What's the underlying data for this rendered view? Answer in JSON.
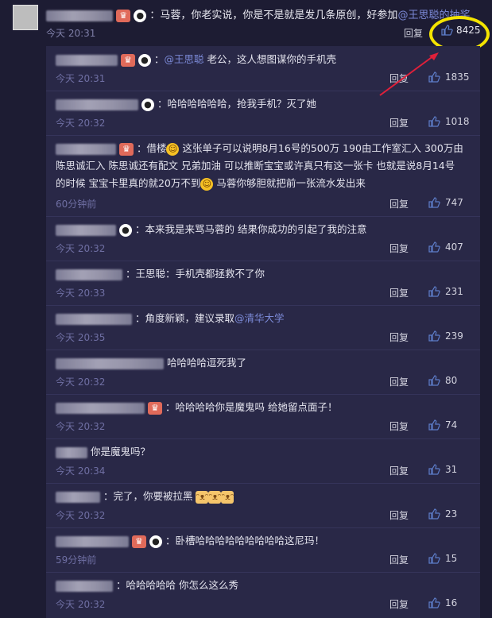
{
  "top_comment": {
    "text": "：马蓉，你老实说，你是不是就是发几条原创，好参加",
    "mention": "@王思聪的抽奖",
    "time": "今天 20:31",
    "reply_label": "回复",
    "likes": "8425"
  },
  "replies": [
    {
      "prefix": "：",
      "mention": "@王思聪",
      "text": " 老公，这人想图谋你的手机壳",
      "time": "今天 20:31",
      "reply": "回复",
      "likes": "1835"
    },
    {
      "prefix": "：",
      "text": "哈哈哈哈哈哈，抢我手机？灭了她",
      "time": "今天 20:32",
      "reply": "回复",
      "likes": "1018"
    },
    {
      "text1": "：借楼",
      "text2": " 这张单子可以说明8月16号的500万 190由工作室汇入 300万由",
      "text3": "陈思诚汇入 陈思诚还有配文 兄弟加油 可以推断宝宝或许真只有这一张卡 也就是说8月14号",
      "text4": "的时候 宝宝卡里真的就20万不到",
      "text5": " 马蓉你够胆就把前一张流水发出来",
      "time": "60分钟前",
      "reply": "回复",
      "likes": "747"
    },
    {
      "text": "：本来我是来骂马蓉的 结果你成功的引起了我的注意",
      "time": "今天 20:32",
      "reply": "回复",
      "likes": "407"
    },
    {
      "text": "：王思聪：手机壳都拯救不了你",
      "time": "今天 20:33",
      "reply": "回复",
      "likes": "231"
    },
    {
      "text": "：角度新颖，建议录取",
      "mention": "@清华大学",
      "time": "今天 20:35",
      "reply": "回复",
      "likes": "239"
    },
    {
      "text": "哈哈哈哈逗死我了",
      "time": "今天 20:32",
      "reply": "回复",
      "likes": "80"
    },
    {
      "text": "：哈哈哈哈你是魔鬼吗 给她留点面子！",
      "time": "今天 20:32",
      "reply": "回复",
      "likes": "74"
    },
    {
      "text": "你是魔鬼吗？",
      "time": "今天 20:34",
      "reply": "回复",
      "likes": "31"
    },
    {
      "text": "：完了，你要被拉黑",
      "time": "今天 20:32",
      "reply": "回复",
      "likes": "23"
    },
    {
      "text": "：卧槽哈哈哈哈哈哈哈哈哈这尼玛！",
      "time": "59分钟前",
      "reply": "回复",
      "likes": "15"
    },
    {
      "text": "：哈哈哈哈哈  你怎么这么秀",
      "time": "今天 20:32",
      "reply": "回复",
      "likes": "16"
    }
  ],
  "icons": {
    "like": "thumbs-up-icon",
    "highlight_color": "#f4e400",
    "arrow_color": "#e0203a"
  }
}
